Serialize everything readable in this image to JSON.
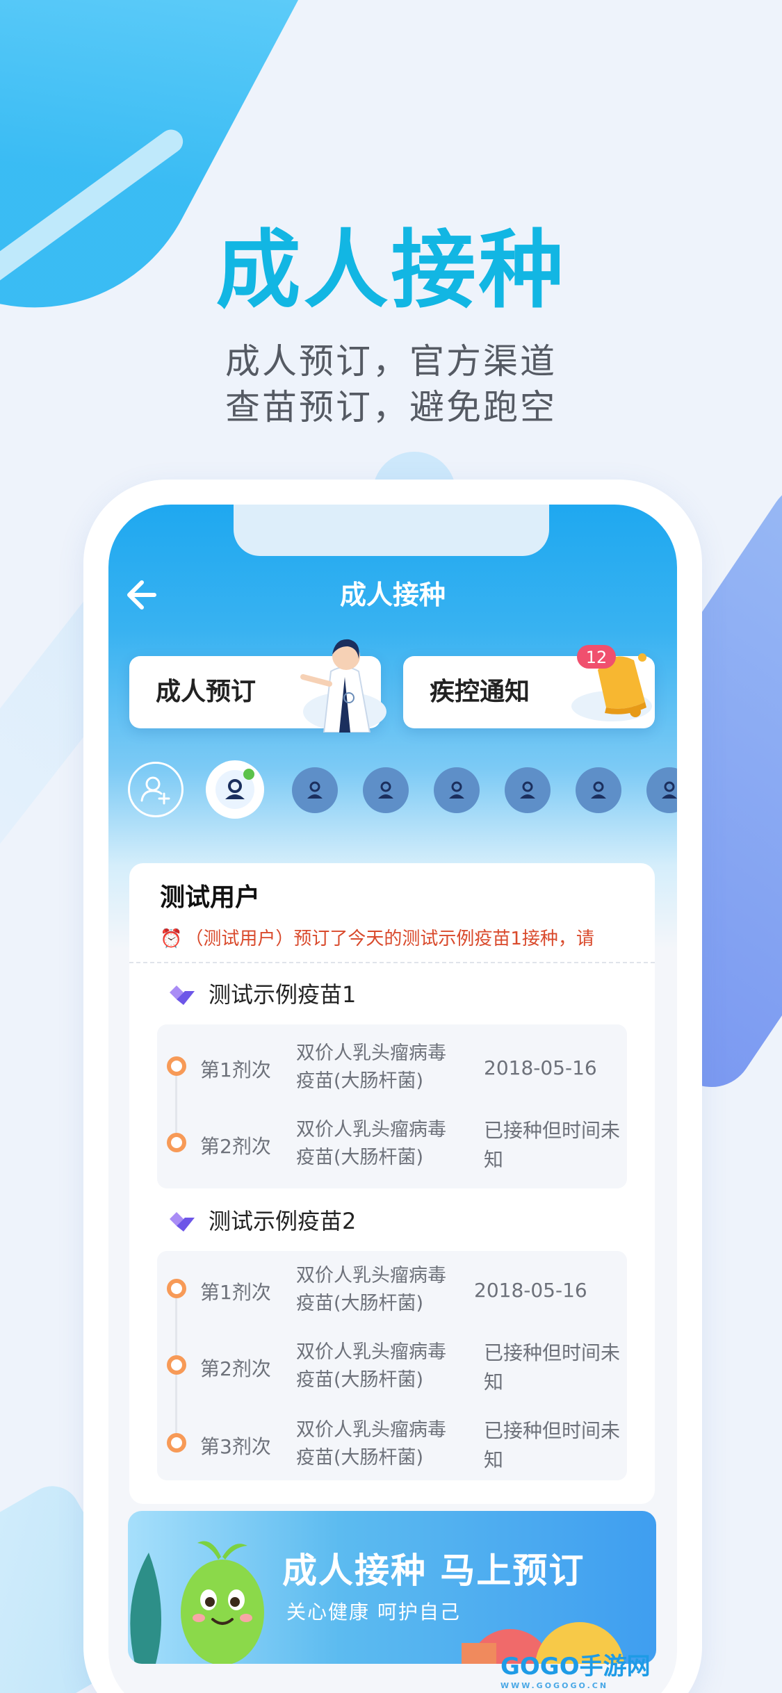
{
  "hero": {
    "title": "成人接种",
    "subtitle_line1": "成人预订，官方渠道",
    "subtitle_line2": "查苗预订，避免跑空"
  },
  "app_header": {
    "back_icon": "arrow-left-icon",
    "title": "成人接种"
  },
  "quick_actions": [
    {
      "label": "成人预订",
      "icon": "doctor-illustration"
    },
    {
      "label": "疾控通知",
      "icon": "bell-icon",
      "badge": "12"
    }
  ],
  "avatars": {
    "add_icon": "add-user-icon",
    "count_others": 6
  },
  "record": {
    "user_name": "测试用户",
    "notice": "（测试用户）预订了今天的测试示例疫苗1接种，请",
    "vaccines": [
      {
        "name": "测试示例疫苗1",
        "doses": [
          {
            "dose": "第1剂次",
            "name": "双价人乳头瘤病毒疫苗(大肠杆菌)",
            "status": "2018-05-16"
          },
          {
            "dose": "第2剂次",
            "name": "双价人乳头瘤病毒疫苗(大肠杆菌)",
            "status": "已接种但时间未知"
          }
        ]
      },
      {
        "name": "测试示例疫苗2",
        "doses": [
          {
            "dose": "第1剂次",
            "name": "双价人乳头瘤病毒疫苗(大肠杆菌)",
            "status": "2018-05-16"
          },
          {
            "dose": "第2剂次",
            "name": "双价人乳头瘤病毒疫苗(大肠杆菌)",
            "status": "已接种但时间未知"
          },
          {
            "dose": "第3剂次",
            "name": "双价人乳头瘤病毒疫苗(大肠杆菌)",
            "status": "已接种但时间未知"
          }
        ]
      }
    ]
  },
  "banner": {
    "title": "成人接种  马上预订",
    "subtitle": "关心健康   呵护自己"
  },
  "watermark": {
    "text": "GOGO手游网",
    "url_text": "WWW.GOGOGO.CN"
  },
  "colors": {
    "accent": "#12b6e3",
    "header_blue": "#1fa8f0",
    "notice_red": "#d94a2c",
    "dose_dot": "#f79a57"
  }
}
